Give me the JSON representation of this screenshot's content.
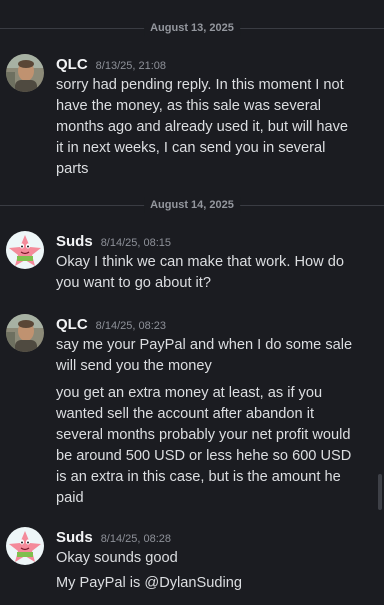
{
  "dividers": [
    {
      "date": "August 13, 2025"
    },
    {
      "date": "August 14, 2025"
    }
  ],
  "messages": [
    {
      "author": "QLC",
      "timestamp": "8/13/25, 21:08",
      "avatar": "qlc-avatar-icon",
      "lines": "sorry had pending reply. In this moment I not\nhave the money, as this sale was several\nmonths ago and already used it, but will have\nit in next weeks, I can send you in several\nparts"
    },
    {
      "author": "Suds",
      "timestamp": "8/14/25, 08:15",
      "avatar": "patrick-star-avatar-icon",
      "lines": "Okay I think we can make that work. How do\nyou want to go about it?"
    },
    {
      "author": "QLC",
      "timestamp": "8/14/25, 08:23",
      "avatar": "qlc-avatar-icon",
      "lines": "say me your PayPal and when I do some sale\nwill send you the money",
      "followup": "you get an extra money at least, as if you\nwanted sell the account after abandon it\nseveral months probably your net profit would\nbe around 500 USD or less hehe so 600 USD\nis an extra in this case, but is the amount he\npaid"
    },
    {
      "author": "Suds",
      "timestamp": "8/14/25, 08:28",
      "avatar": "patrick-star-avatar-icon",
      "lines": "Okay sounds good",
      "followup": "My PayPal is @DylanSuding"
    }
  ],
  "colors": {
    "background": "#1b1c21",
    "text": "#dcdee1",
    "author": "#f2f3f5",
    "timestamp": "#8e9199",
    "divider": "#3a3c43"
  }
}
